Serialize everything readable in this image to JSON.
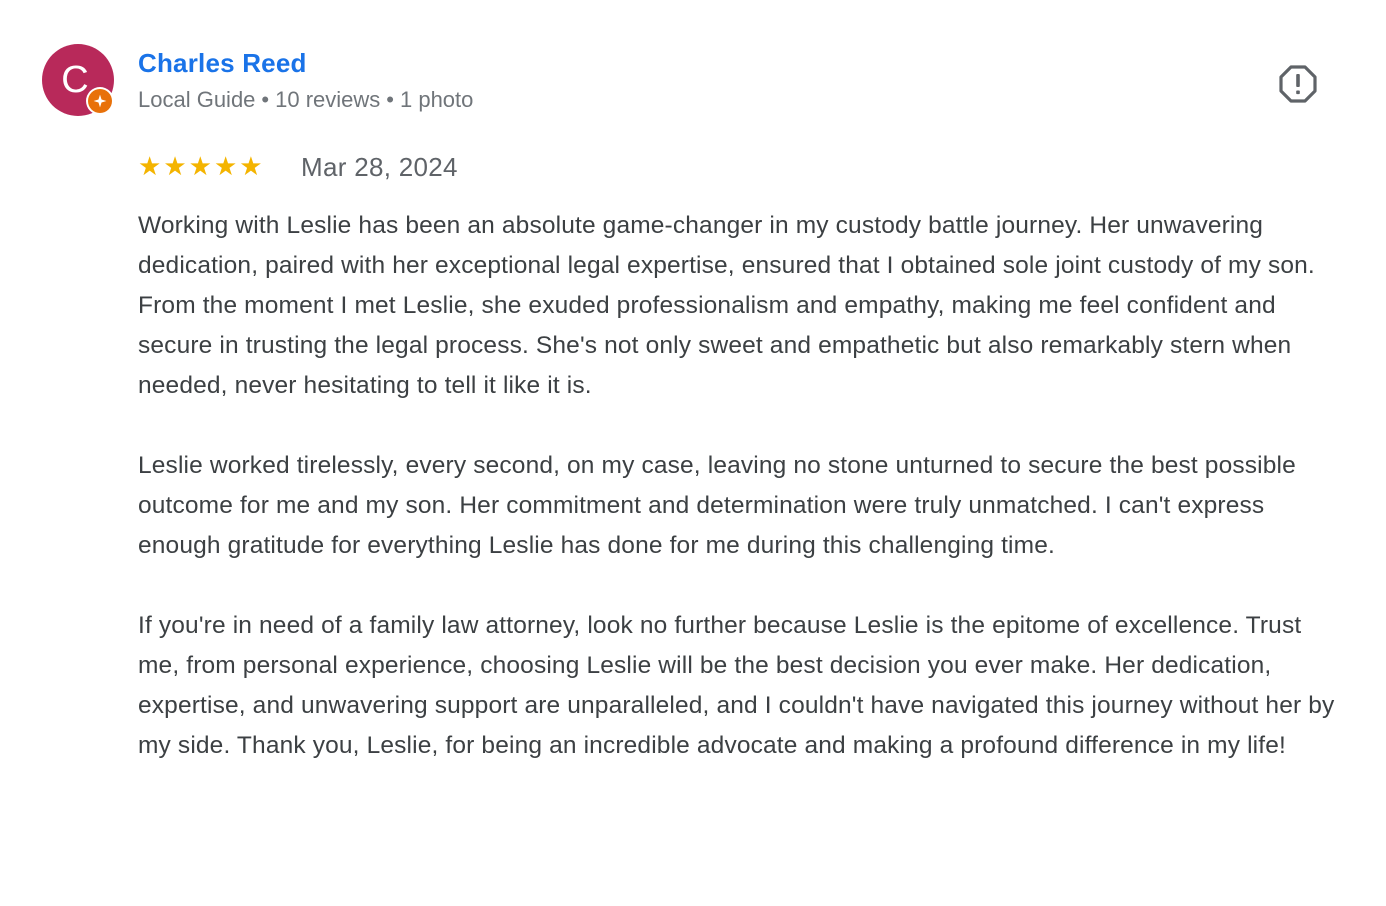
{
  "reviewer": {
    "initial": "C",
    "name": "Charles Reed",
    "level": "Local Guide",
    "reviews": "10 reviews",
    "photos": "1 photo",
    "separator": "•",
    "avatar_color": "#b8295a",
    "badge_color": "#e8710a"
  },
  "report_icon": "report-flag-icon",
  "review": {
    "rating": 5,
    "max_rating": 5,
    "star_color": "#f4b400",
    "date": "Mar 28, 2024",
    "paragraphs": [
      "Working with Leslie has been an absolute game-changer in my custody battle journey. Her unwavering dedication, paired with her exceptional legal expertise, ensured that I obtained sole joint custody of my son. From the moment I met Leslie, she exuded professionalism and empathy, making me feel confident and secure in trusting the legal process. She's not only sweet and empathetic but also remarkably stern when needed, never hesitating to tell it like it is.",
      "Leslie worked tirelessly, every second, on my case, leaving no stone unturned to secure the best possible outcome for me and my son. Her commitment and determination were truly unmatched. I can't express enough gratitude for everything Leslie has done for me during this challenging time.",
      "If you're in need of a family law attorney, look no further because Leslie is the epitome of excellence. Trust me, from personal experience, choosing Leslie will be the best decision you ever make. Her dedication, expertise, and unwavering support are unparalleled, and I couldn't have navigated this journey without her by my side. Thank you, Leslie, for being an incredible advocate and making a profound difference in my life!"
    ]
  }
}
